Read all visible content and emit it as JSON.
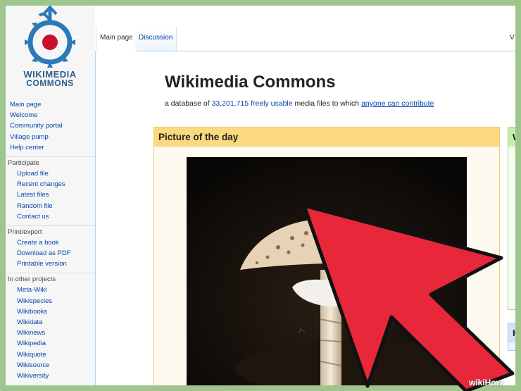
{
  "logo": {
    "line1": "WIKIMEDIA",
    "line2": "COMMONS"
  },
  "sidebar": {
    "primary": [
      {
        "label": "Main page"
      },
      {
        "label": "Welcome"
      },
      {
        "label": "Community portal"
      },
      {
        "label": "Village pump"
      },
      {
        "label": "Help center"
      }
    ],
    "participate": {
      "heading": "Participate",
      "items": [
        {
          "label": "Upload file"
        },
        {
          "label": "Recent changes"
        },
        {
          "label": "Latest files"
        },
        {
          "label": "Random file"
        },
        {
          "label": "Contact us"
        }
      ]
    },
    "print": {
      "heading": "Print/export",
      "items": [
        {
          "label": "Create a book"
        },
        {
          "label": "Download as PDF"
        },
        {
          "label": "Printable version"
        }
      ]
    },
    "projects": {
      "heading": "In other projects",
      "items": [
        {
          "label": "Meta-Wiki"
        },
        {
          "label": "Wikispecies"
        },
        {
          "label": "Wikibooks"
        },
        {
          "label": "Wikidata"
        },
        {
          "label": "Wikinews"
        },
        {
          "label": "Wikipedia"
        },
        {
          "label": "Wikiquote"
        },
        {
          "label": "Wikisource"
        },
        {
          "label": "Wikiversity"
        }
      ]
    }
  },
  "tabs": {
    "main": "Main page",
    "discussion": "Discussion",
    "cut": "V"
  },
  "page": {
    "title": "Wikimedia Commons",
    "subtitle_prefix": "a database of ",
    "file_count": "33,201,715",
    "freely_usable": "freely usable",
    "subtitle_middle": " media files to which ",
    "anyone_link": "anyone can contribute"
  },
  "potd": {
    "heading": "Picture of the day"
  },
  "right_boxes": {
    "green_initial": "W",
    "blue_initial": "H"
  },
  "watermark": "wikiHow",
  "colors": {
    "link": "#0645ad",
    "potd_header": "#fbd97e",
    "arrow": "#e8283a",
    "frame": "#9ec58c"
  }
}
